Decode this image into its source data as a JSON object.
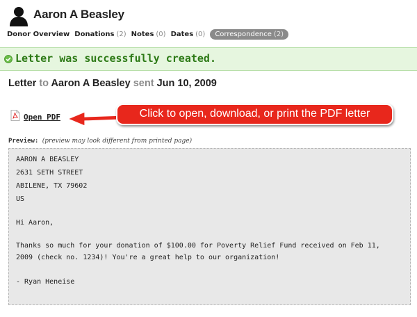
{
  "header": {
    "avatar_icon": "person-silhouette-icon",
    "name": "Aaron A Beasley"
  },
  "tabs": [
    {
      "label": "Donor Overview",
      "count": ""
    },
    {
      "label": "Donations",
      "count": "(2)"
    },
    {
      "label": "Notes",
      "count": "(0)"
    },
    {
      "label": "Dates",
      "count": "(0)"
    },
    {
      "label": "Correspondence",
      "count": "(2)",
      "active": true
    }
  ],
  "success": {
    "icon": "check-circle-icon",
    "message": "Letter was successfully created.",
    "color": "#2d7a16"
  },
  "letter_info": {
    "word_letter": "Letter",
    "word_to": "to",
    "recipient": "Aaron A Beasley",
    "word_sent": "sent",
    "date": "Jun 10, 2009"
  },
  "pdf": {
    "icon": "pdf-file-icon",
    "link_label": "Open PDF"
  },
  "annotation": {
    "text": "Click to open, download, or print the PDF letter",
    "color": "#e8271c"
  },
  "preview": {
    "label": "Preview:",
    "note": "(preview may look different from printed page)",
    "address": [
      "AARON A BEASLEY",
      "2631 SETH STREET",
      "ABILENE, TX 79602",
      "US"
    ],
    "greeting": "Hi Aaron,",
    "body": "Thanks so much for your donation of $100.00 for Poverty Relief Fund received on Feb 11, 2009 (check no. 1234)! You're a great help to our organization!",
    "signature": "- Ryan Heneise"
  }
}
